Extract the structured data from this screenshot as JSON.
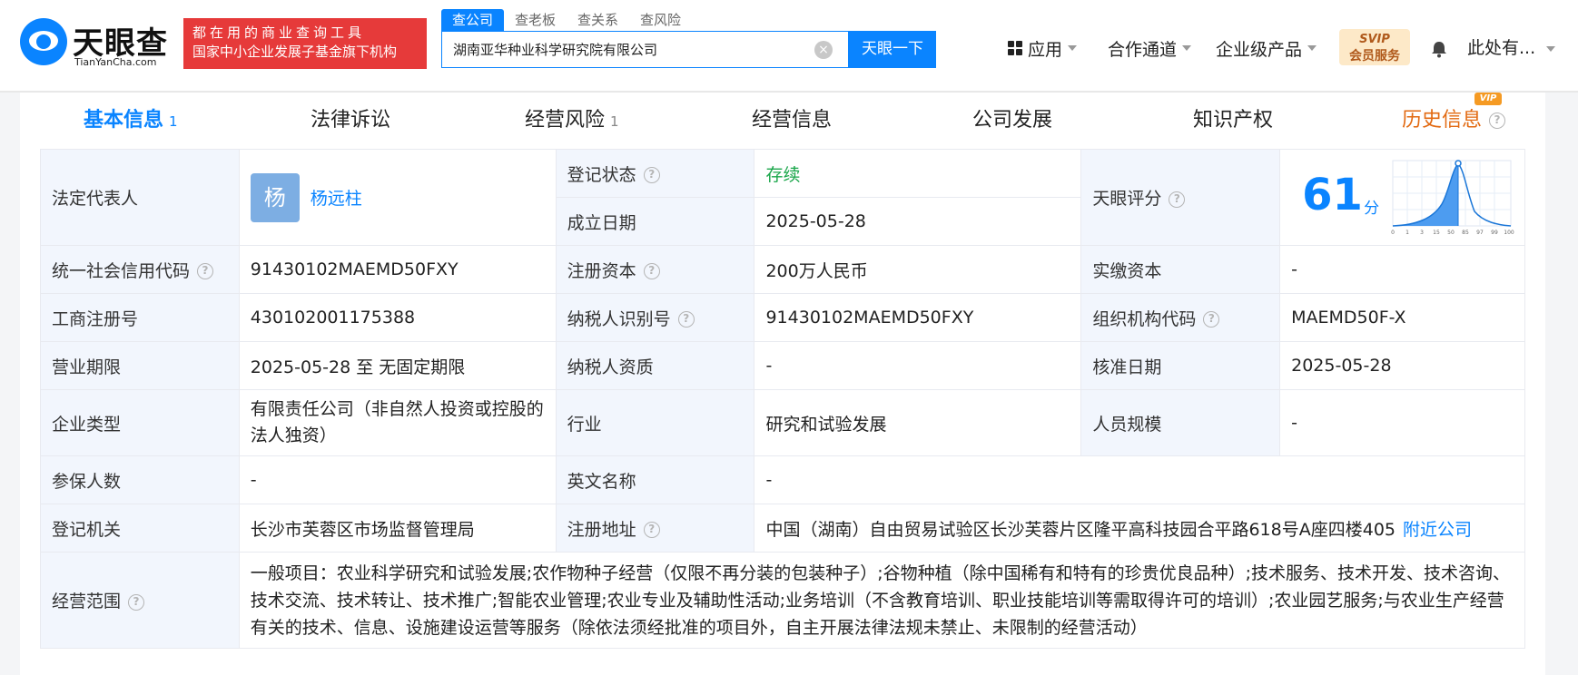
{
  "header": {
    "logo_name": "天眼查",
    "logo_sub": "TianYanCha.com",
    "banner_line1": "都在用的商业查询工具",
    "banner_line2": "国家中小企业发展子基金旗下机构",
    "search_tabs": [
      "查公司",
      "查老板",
      "查关系",
      "查风险"
    ],
    "search_value": "湖南亚华种业科学研究院有限公司",
    "search_button": "天眼一下",
    "nav": {
      "apps": "应用",
      "channel": "合作通道",
      "enterprise": "企业级产品"
    },
    "vip_line1": "SVIP",
    "vip_line2": "会员服务",
    "user": "此处有..."
  },
  "tabs": [
    {
      "label": "基本信息",
      "count": "1"
    },
    {
      "label": "法律诉讼",
      "count": ""
    },
    {
      "label": "经营风险",
      "count": "1"
    },
    {
      "label": "经营信息",
      "count": ""
    },
    {
      "label": "公司发展",
      "count": ""
    },
    {
      "label": "知识产权",
      "count": ""
    },
    {
      "label": "历史信息",
      "count": ""
    }
  ],
  "vip_tag": "VIP",
  "info": {
    "legal_rep_label": "法定代表人",
    "legal_rep_avatar": "杨",
    "legal_rep_name": "杨远柱",
    "reg_status_label": "登记状态",
    "reg_status": "存续",
    "found_date_label": "成立日期",
    "found_date": "2025-05-28",
    "score_label": "天眼评分",
    "score": "61",
    "score_unit": "分",
    "score_axis": [
      "0",
      "1",
      "3",
      "15",
      "50",
      "85",
      "97",
      "99",
      "100"
    ],
    "credit_code_label": "统一社会信用代码",
    "credit_code": "91430102MAEMD50FXY",
    "reg_capital_label": "注册资本",
    "reg_capital": "200万人民币",
    "paid_capital_label": "实缴资本",
    "paid_capital": "-",
    "biz_reg_no_label": "工商注册号",
    "biz_reg_no": "430102001175388",
    "taxpayer_id_label": "纳税人识别号",
    "taxpayer_id": "91430102MAEMD50FXY",
    "org_code_label": "组织机构代码",
    "org_code": "MAEMD50F-X",
    "biz_term_label": "营业期限",
    "biz_term": "2025-05-28 至 无固定期限",
    "taxpayer_qual_label": "纳税人资质",
    "taxpayer_qual": "-",
    "approve_date_label": "核准日期",
    "approve_date": "2025-05-28",
    "company_type_label": "企业类型",
    "company_type": "有限责任公司（非自然人投资或控股的法人独资）",
    "industry_label": "行业",
    "industry": "研究和试验发展",
    "staff_size_label": "人员规模",
    "staff_size": "-",
    "insured_label": "参保人数",
    "insured": "-",
    "english_name_label": "英文名称",
    "english_name": "-",
    "reg_authority_label": "登记机关",
    "reg_authority": "长沙市芙蓉区市场监督管理局",
    "reg_address_label": "注册地址",
    "reg_address": "中国（湖南）自由贸易试验区长沙芙蓉片区隆平高科技园合平路618号A座四楼405",
    "nearby_link": "附近公司",
    "scope_label": "经营范围",
    "scope": "一般项目：农业科学研究和试验发展;农作物种子经营（仅限不再分装的包装种子）;谷物种植（除中国稀有和特有的珍贵优良品种）;技术服务、技术开发、技术咨询、技术交流、技术转让、技术推广;智能农业管理;农业专业及辅助性活动;业务培训（不含教育培训、职业技能培训等需取得许可的培训）;农业园艺服务;与农业生产经营有关的技术、信息、设施建设运营等服务（除依法须经批准的项目外，自主开展法律法规未禁止、未限制的经营活动）"
  },
  "colors": {
    "accent": "#0a84ff",
    "banner": "#e63a3a",
    "status_green": "#1aa64a",
    "history_orange": "#e26a12"
  }
}
